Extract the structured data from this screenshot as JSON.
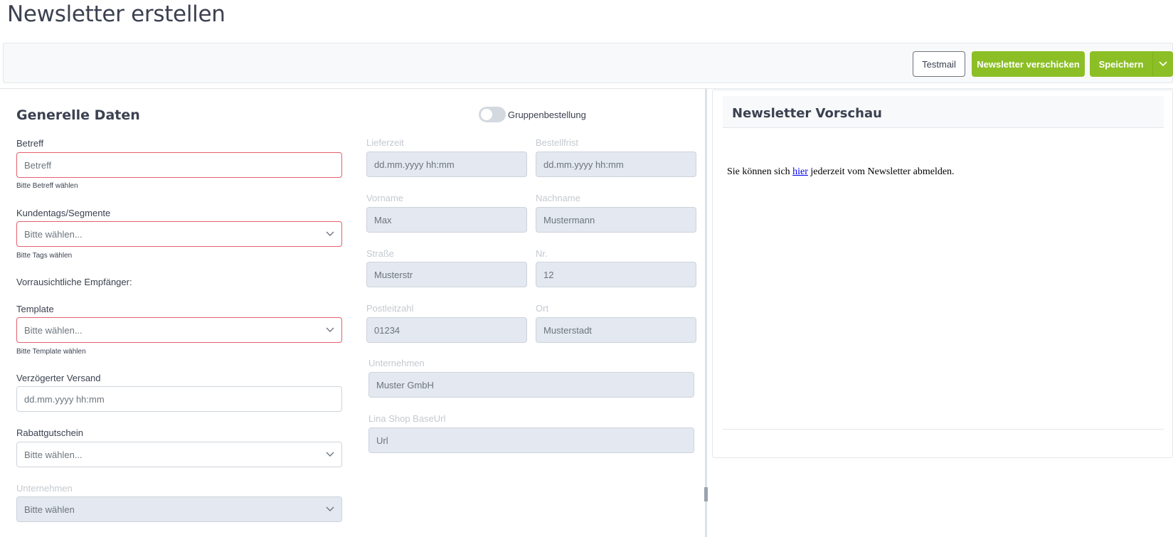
{
  "page": {
    "title": "Newsletter erstellen"
  },
  "toolbar": {
    "testmail_label": "Testmail",
    "send_label": "Newsletter verschicken",
    "save_label": "Speichern"
  },
  "general": {
    "title": "Generelle Daten",
    "betreff": {
      "label": "Betreff",
      "placeholder": "Betreff",
      "hint": "Bitte Betreff wählen"
    },
    "kundentags": {
      "label": "Kundentags/Segmente",
      "value": "Bitte wählen...",
      "hint": "Bitte Tags wählen"
    },
    "empfaenger_label": "Vorrausichtliche Empfänger:",
    "template": {
      "label": "Template",
      "value": "Bitte wählen...",
      "hint": "Bitte Template wählen"
    },
    "versand": {
      "label": "Verzögerter Versand",
      "placeholder": "dd.mm.yyyy hh:mm"
    },
    "rabatt": {
      "label": "Rabattgutschein",
      "value": "Bitte wählen..."
    },
    "unternehmen": {
      "label": "Unternehmen",
      "value": "Bitte wählen"
    }
  },
  "group": {
    "toggle_label": "Gruppenbestellung",
    "lieferzeit": {
      "label": "Lieferzeit",
      "value": "dd.mm.yyyy hh:mm"
    },
    "bestellfrist": {
      "label": "Bestellfrist",
      "value": "dd.mm.yyyy hh:mm"
    },
    "vorname": {
      "label": "Vorname",
      "value": "Max"
    },
    "nachname": {
      "label": "Nachname",
      "value": "Mustermann"
    },
    "strasse": {
      "label": "Straße",
      "value": "Musterstr"
    },
    "nr": {
      "label": "Nr.",
      "value": "12"
    },
    "plz": {
      "label": "Postleitzahl",
      "value": "01234"
    },
    "ort": {
      "label": "Ort",
      "value": "Musterstadt"
    },
    "unternehmen": {
      "label": "Unternehmen",
      "value": "Muster GmbH"
    },
    "baseurl": {
      "label": "Lina Shop BaseUrl",
      "value": "Url"
    }
  },
  "preview": {
    "title": "Newsletter Vorschau",
    "text_before": "Sie können sich ",
    "link_text": "hier",
    "text_after": " jederzeit vom Newsletter abmelden."
  },
  "colors": {
    "accent": "#8cbf26",
    "invalid": "#e4606d",
    "disabled_bg": "#e4e8f0"
  }
}
